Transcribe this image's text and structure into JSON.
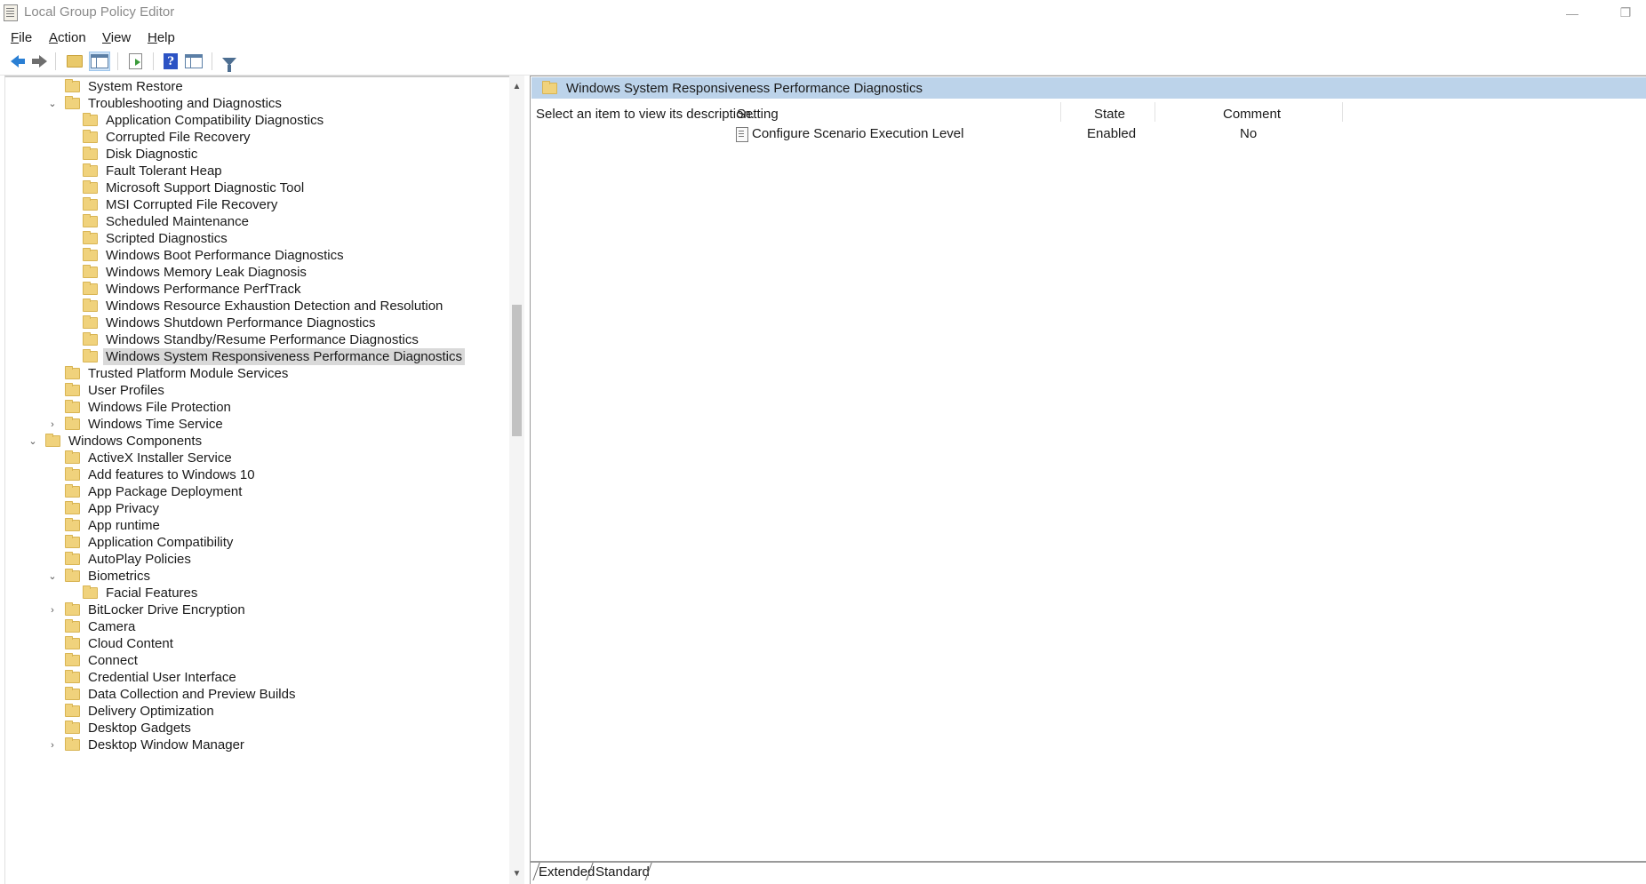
{
  "window": {
    "title": "Local Group Policy Editor"
  },
  "menu": [
    {
      "label": "File",
      "accel": "F",
      "rest": "ile"
    },
    {
      "label": "Action",
      "accel": "A",
      "rest": "ction"
    },
    {
      "label": "View",
      "accel": "V",
      "rest": "iew"
    },
    {
      "label": "Help",
      "accel": "H",
      "rest": "elp"
    }
  ],
  "toolbar": {
    "buttons": [
      "back-arrow-icon",
      "forward-arrow-icon",
      "up-one-level-icon",
      "show-hide-console-tree-icon",
      "export-list-icon",
      "help-icon",
      "show-hide-action-pane-icon",
      "filter-icon"
    ],
    "accent": "#2a7fd4"
  },
  "tree": [
    {
      "label": "System Restore",
      "level": 2,
      "expander": ""
    },
    {
      "label": "Troubleshooting and Diagnostics",
      "level": 2,
      "expander": "v"
    },
    {
      "label": "Application Compatibility Diagnostics",
      "level": 3,
      "expander": ""
    },
    {
      "label": "Corrupted File Recovery",
      "level": 3,
      "expander": ""
    },
    {
      "label": "Disk Diagnostic",
      "level": 3,
      "expander": ""
    },
    {
      "label": "Fault Tolerant Heap",
      "level": 3,
      "expander": ""
    },
    {
      "label": "Microsoft Support Diagnostic Tool",
      "level": 3,
      "expander": ""
    },
    {
      "label": "MSI Corrupted File Recovery",
      "level": 3,
      "expander": ""
    },
    {
      "label": "Scheduled Maintenance",
      "level": 3,
      "expander": ""
    },
    {
      "label": "Scripted Diagnostics",
      "level": 3,
      "expander": ""
    },
    {
      "label": "Windows Boot Performance Diagnostics",
      "level": 3,
      "expander": ""
    },
    {
      "label": "Windows Memory Leak Diagnosis",
      "level": 3,
      "expander": ""
    },
    {
      "label": "Windows Performance PerfTrack",
      "level": 3,
      "expander": ""
    },
    {
      "label": "Windows Resource Exhaustion Detection and Resolution",
      "level": 3,
      "expander": ""
    },
    {
      "label": "Windows Shutdown Performance Diagnostics",
      "level": 3,
      "expander": ""
    },
    {
      "label": "Windows Standby/Resume Performance Diagnostics",
      "level": 3,
      "expander": ""
    },
    {
      "label": "Windows System Responsiveness Performance Diagnostics",
      "level": 3,
      "expander": "",
      "selected": true
    },
    {
      "label": "Trusted Platform Module Services",
      "level": 2,
      "expander": ""
    },
    {
      "label": "User Profiles",
      "level": 2,
      "expander": ""
    },
    {
      "label": "Windows File Protection",
      "level": 2,
      "expander": ""
    },
    {
      "label": "Windows Time Service",
      "level": 2,
      "expander": ">"
    },
    {
      "label": "Windows Components",
      "level": 1,
      "expander": "v"
    },
    {
      "label": "ActiveX Installer Service",
      "level": 2,
      "expander": ""
    },
    {
      "label": "Add features to Windows 10",
      "level": 2,
      "expander": ""
    },
    {
      "label": "App Package Deployment",
      "level": 2,
      "expander": ""
    },
    {
      "label": "App Privacy",
      "level": 2,
      "expander": ""
    },
    {
      "label": "App runtime",
      "level": 2,
      "expander": ""
    },
    {
      "label": "Application Compatibility",
      "level": 2,
      "expander": ""
    },
    {
      "label": "AutoPlay Policies",
      "level": 2,
      "expander": ""
    },
    {
      "label": "Biometrics",
      "level": 2,
      "expander": "v"
    },
    {
      "label": "Facial Features",
      "level": 3,
      "expander": ""
    },
    {
      "label": "BitLocker Drive Encryption",
      "level": 2,
      "expander": ">"
    },
    {
      "label": "Camera",
      "level": 2,
      "expander": ""
    },
    {
      "label": "Cloud Content",
      "level": 2,
      "expander": ""
    },
    {
      "label": "Connect",
      "level": 2,
      "expander": ""
    },
    {
      "label": "Credential User Interface",
      "level": 2,
      "expander": ""
    },
    {
      "label": "Data Collection and Preview Builds",
      "level": 2,
      "expander": ""
    },
    {
      "label": "Delivery Optimization",
      "level": 2,
      "expander": ""
    },
    {
      "label": "Desktop Gadgets",
      "level": 2,
      "expander": ""
    },
    {
      "label": "Desktop Window Manager",
      "level": 2,
      "expander": ">"
    }
  ],
  "details": {
    "header_title": "Windows System Responsiveness Performance Diagnostics",
    "description": "Select an item to view its description.",
    "columns": {
      "setting": "Setting",
      "state": "State",
      "comment": "Comment"
    },
    "rows": [
      {
        "setting": "Configure Scenario Execution Level",
        "state": "Enabled",
        "comment": "No"
      }
    ],
    "header_color": "#bcd3ea"
  },
  "tabs": [
    {
      "label": "Extended",
      "active": true
    },
    {
      "label": "Standard",
      "active": false
    }
  ]
}
